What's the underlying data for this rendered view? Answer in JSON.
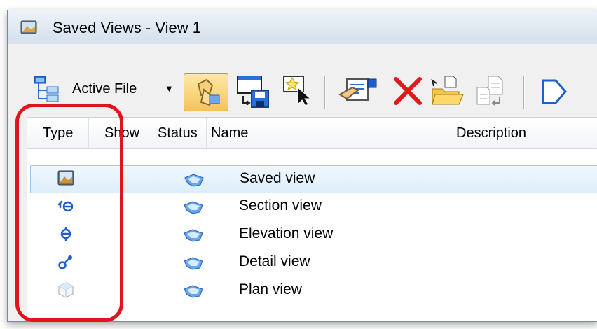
{
  "window": {
    "title": "Saved Views - View 1"
  },
  "toolbar": {
    "active_file_label": "Active File",
    "buttons": [
      {
        "name": "active-file-icon"
      },
      {
        "name": "apply-view-icon"
      },
      {
        "name": "save-view-icon"
      },
      {
        "name": "select-view-icon"
      },
      {
        "name": "properties-icon"
      },
      {
        "name": "delete-icon"
      },
      {
        "name": "open-folder-icon"
      },
      {
        "name": "import-icon"
      },
      {
        "name": "next-icon"
      }
    ]
  },
  "table": {
    "columns": [
      "Type",
      "Show",
      "Status",
      "Name",
      "Description"
    ],
    "rows": [
      {
        "type_icon": "saved-view-icon",
        "status_icon": "status-icon",
        "name": "Saved view",
        "description": "",
        "selected": true
      },
      {
        "type_icon": "section-view-icon",
        "status_icon": "status-icon",
        "name": "Section view",
        "description": "",
        "selected": false
      },
      {
        "type_icon": "elevation-view-icon",
        "status_icon": "status-icon",
        "name": "Elevation view",
        "description": "",
        "selected": false
      },
      {
        "type_icon": "detail-view-icon",
        "status_icon": "status-icon",
        "name": "Detail view",
        "description": "",
        "selected": false
      },
      {
        "type_icon": "plan-view-icon",
        "status_icon": "status-icon",
        "name": "Plan view",
        "description": "",
        "selected": false
      }
    ]
  },
  "colors": {
    "highlight_outline": "#e2141b",
    "selection_fill": "#dceefc",
    "icon_blue": "#1f5fc9"
  }
}
